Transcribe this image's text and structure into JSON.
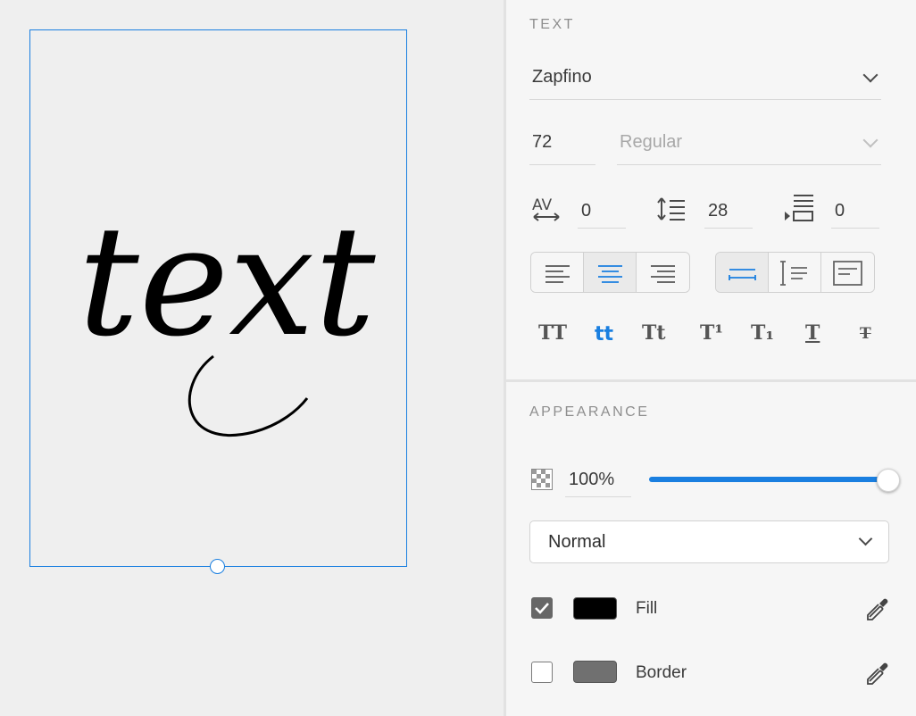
{
  "canvas": {
    "frame_text": "text"
  },
  "text_section": {
    "title": "TEXT",
    "font_family": "Zapfino",
    "font_size": "72",
    "font_weight": "Regular",
    "char_spacing": "0",
    "line_spacing": "28",
    "paragraph_spacing": "0",
    "alignment_selected": "center",
    "case_options": [
      "TT",
      "tt",
      "Tt",
      "T¹",
      "T₁",
      "T",
      "T"
    ],
    "case_selected": "tt"
  },
  "appearance_section": {
    "title": "APPEARANCE",
    "opacity": "100%",
    "opacity_level": 1.0,
    "blend_mode": "Normal",
    "fill_label": "Fill",
    "fill_checked": true,
    "fill_color": "#000000",
    "border_label": "Border",
    "border_checked": false,
    "border_color": "#707070"
  },
  "colors": {
    "accent": "#1a7fe0"
  }
}
